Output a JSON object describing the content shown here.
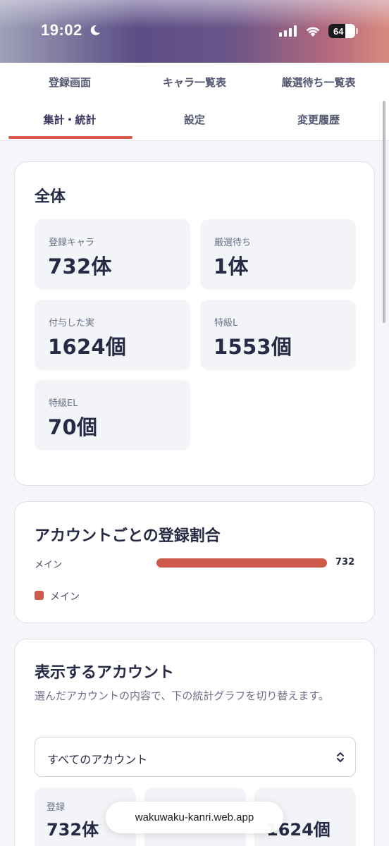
{
  "status_bar": {
    "time": "19:02",
    "battery": "64"
  },
  "tabs": [
    {
      "label": "登録画面",
      "active": false
    },
    {
      "label": "キャラ一覧表",
      "active": false
    },
    {
      "label": "厳選待ち一覧表",
      "active": false
    },
    {
      "label": "集計・統計",
      "active": true
    },
    {
      "label": "設定",
      "active": false
    },
    {
      "label": "変更履歴",
      "active": false
    }
  ],
  "overall": {
    "title": "全体",
    "stats": [
      {
        "label": "登録キャラ",
        "value": "732体"
      },
      {
        "label": "厳選待ち",
        "value": "1体"
      },
      {
        "label": "付与した実",
        "value": "1624個"
      },
      {
        "label": "特級L",
        "value": "1553個"
      },
      {
        "label": "特級EL",
        "value": "70個"
      }
    ]
  },
  "account_ratio": {
    "title": "アカウントごとの登録割合",
    "bar_label": "メイン",
    "bar_value": "732",
    "legend_label": "メイン"
  },
  "chart_data": {
    "type": "bar",
    "categories": [
      "メイン"
    ],
    "values": [
      732
    ],
    "title": "アカウントごとの登録割合",
    "xlabel": "",
    "ylabel": "",
    "orientation": "horizontal",
    "colors": [
      "#cd5a4b"
    ],
    "legend": [
      "メイン"
    ],
    "legend_placement": "bottom-left"
  },
  "display_account": {
    "title": "表示するアカウント",
    "description": "選んだアカウントの内容で、下の統計グラフを切り替えます。",
    "select_value": "すべてのアカウント",
    "mini_stats": [
      {
        "label": "登録",
        "value": "732体"
      },
      {
        "label": "",
        "value": ""
      },
      {
        "label": "",
        "value": "1624個"
      }
    ]
  },
  "browser": {
    "url": "wakuwaku-kanri.web.app"
  },
  "colors": {
    "accent": "#cd5a4b",
    "text": "#262a44",
    "muted": "#6c6f86",
    "surface": "#f3f4f8"
  }
}
